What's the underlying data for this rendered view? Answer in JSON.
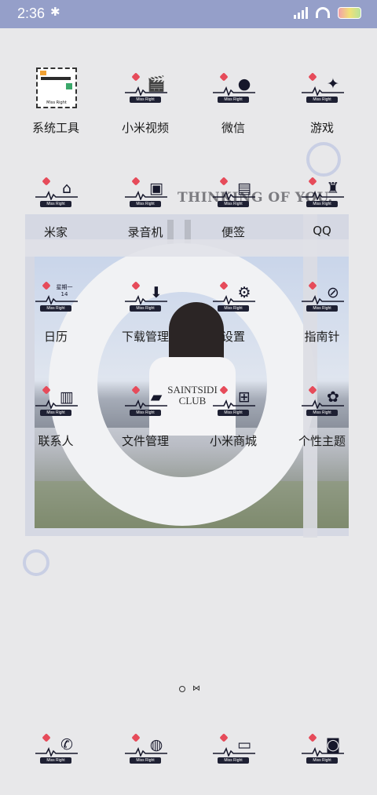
{
  "status_bar": {
    "time": "2:36",
    "bluetooth_icon": "bluetooth-icon"
  },
  "wallpaper": {
    "heading": "THINKING OF YOU.",
    "shirt_text": "SAINTSIDI\nCLUB"
  },
  "icon_tag_text": "Miss Right",
  "apps": [
    {
      "label": "系统工具",
      "icon": "folder-icon"
    },
    {
      "label": "小米视频",
      "icon": "clapperboard-icon"
    },
    {
      "label": "微信",
      "icon": "wechat-icon"
    },
    {
      "label": "游戏",
      "icon": "gamepad-icon"
    },
    {
      "label": "米家",
      "icon": "home-icon"
    },
    {
      "label": "录音机",
      "icon": "cassette-icon"
    },
    {
      "label": "便签",
      "icon": "note-icon"
    },
    {
      "label": "QQ",
      "icon": "penguin-icon"
    },
    {
      "label": "日历",
      "icon": "calendar-icon",
      "calendar_text": "星期一",
      "calendar_day": "14"
    },
    {
      "label": "下载管理",
      "icon": "download-icon"
    },
    {
      "label": "设置",
      "icon": "gear-icon"
    },
    {
      "label": "指南针",
      "icon": "compass-icon"
    },
    {
      "label": "联系人",
      "icon": "contacts-icon"
    },
    {
      "label": "文件管理",
      "icon": "folder-files-icon"
    },
    {
      "label": "小米商城",
      "icon": "cart-icon"
    },
    {
      "label": "个性主题",
      "icon": "palette-icon"
    }
  ],
  "dock": [
    {
      "icon": "phone-icon"
    },
    {
      "icon": "planet-browser-icon"
    },
    {
      "icon": "message-icon"
    },
    {
      "icon": "camera-icon"
    }
  ],
  "colors": {
    "status_bar": "#959fc9",
    "background": "#e8e8ea",
    "heart": "#e64b5a",
    "glyph": "#16172b"
  }
}
